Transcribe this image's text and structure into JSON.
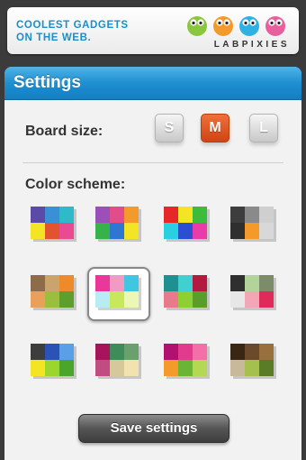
{
  "banner": {
    "tagline_line1": "COOLEST GADGETS",
    "tagline_line2": "ON THE WEB.",
    "brand": "LABPIXIES",
    "creature_colors": [
      "#8bc63f",
      "#f39a2b",
      "#2fb1e4",
      "#e85f9e"
    ]
  },
  "settings": {
    "title": "Settings",
    "board_size_label": "Board size:",
    "sizes": [
      {
        "label": "S",
        "selected": false
      },
      {
        "label": "M",
        "selected": true
      },
      {
        "label": "L",
        "selected": false
      }
    ],
    "color_scheme_label": "Color scheme:",
    "color_schemes": [
      {
        "colors": [
          "#5b4aa6",
          "#3a8fd6",
          "#2ebac9",
          "#f3e424",
          "#e25430",
          "#e94a92"
        ],
        "selected": false
      },
      {
        "colors": [
          "#9b4fb8",
          "#e34c8a",
          "#f39a2b",
          "#35b34a",
          "#2f76d2",
          "#f3e424"
        ],
        "selected": false
      },
      {
        "colors": [
          "#e52727",
          "#f3e424",
          "#3dbb3a",
          "#29d0e0",
          "#2b4ed3",
          "#e93ca8"
        ],
        "selected": false
      },
      {
        "colors": [
          "#3d3d3d",
          "#8a8a8a",
          "#cfcfcf",
          "#2f2f2f",
          "#f39a2b",
          "#d8d8d8"
        ],
        "selected": false
      },
      {
        "colors": [
          "#8e6b4a",
          "#c9a46d",
          "#ef8a2b",
          "#e9a05a",
          "#9bbf3d",
          "#5d9e2d"
        ],
        "selected": false
      },
      {
        "colors": [
          "#e9389a",
          "#f29ac4",
          "#3fc6e0",
          "#b7ecf5",
          "#c6e85a",
          "#ecf7b5"
        ],
        "selected": true
      },
      {
        "colors": [
          "#1f8f8f",
          "#40d0d0",
          "#b21a3f",
          "#e87a8c",
          "#8ed033",
          "#5a9e2a"
        ],
        "selected": false
      },
      {
        "colors": [
          "#2f2f2f",
          "#b2d49a",
          "#7c8c6a",
          "#e7e7e7",
          "#f2a6b6",
          "#df2a5a"
        ],
        "selected": false
      },
      {
        "colors": [
          "#3d3d3d",
          "#2b53b5",
          "#5aa0e8",
          "#f3e424",
          "#9bd62e",
          "#4aa52a"
        ],
        "selected": false
      },
      {
        "colors": [
          "#a8145c",
          "#3e8c5a",
          "#6aa06e",
          "#c04c82",
          "#d6c89a",
          "#f2e2b0"
        ],
        "selected": false
      },
      {
        "colors": [
          "#b2126f",
          "#e23a8d",
          "#f46ea8",
          "#f39a2b",
          "#6ab535",
          "#b3d954"
        ],
        "selected": false
      },
      {
        "colors": [
          "#3a2615",
          "#6b4a2c",
          "#9a6f3e",
          "#c7b99a",
          "#a6c04d",
          "#5b7c26"
        ],
        "selected": false
      }
    ],
    "save_label": "Save settings"
  }
}
